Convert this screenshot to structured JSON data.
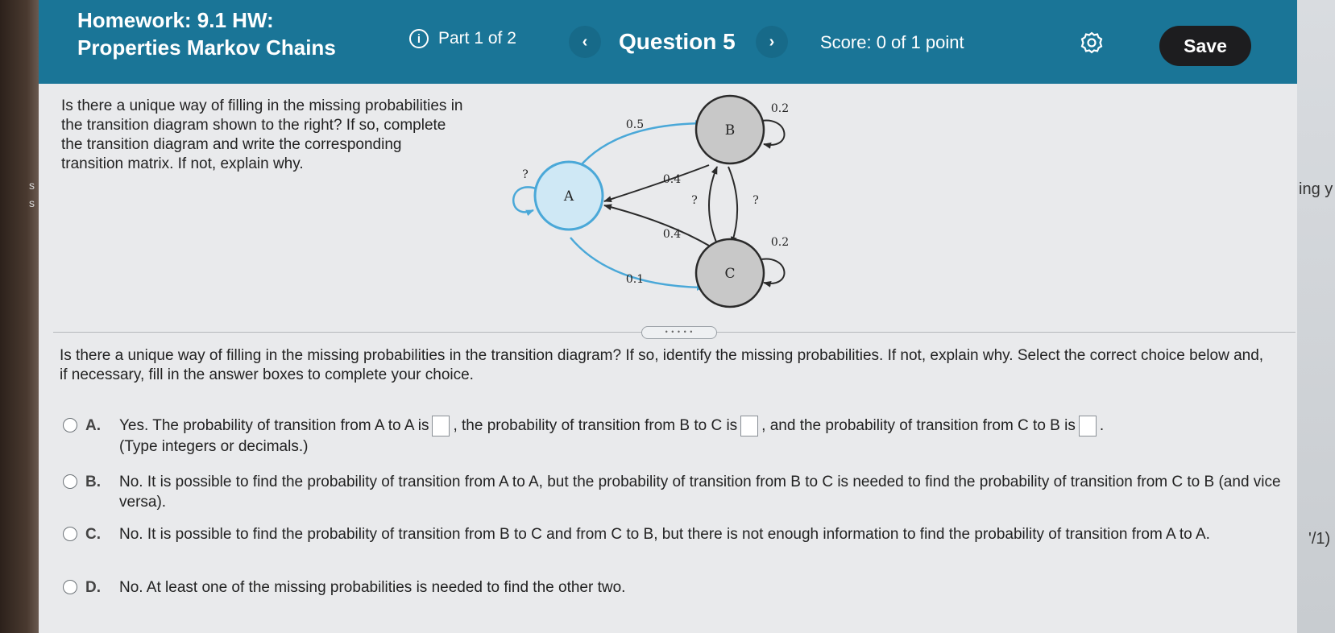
{
  "left_fragments": [
    "s",
    "s"
  ],
  "right_fragments": [
    "ing y",
    "'/1)"
  ],
  "header": {
    "title_line1": "Homework: 9.1 HW:",
    "title_line2": "Properties Markov Chains",
    "part": "Part 1 of 2",
    "question": "Question 5",
    "score": "Score: 0 of 1 point",
    "save_label": "Save"
  },
  "prompt": "Is there a unique way of filling in the missing probabilities in the transition diagram shown to the right? If so, complete the transition diagram and write the corresponding transition matrix. If not, explain why.",
  "diagram": {
    "nodes": {
      "a": "A",
      "b": "B",
      "c": "C"
    },
    "labels": {
      "a_to_b": "0.5",
      "b_to_a": "0.4",
      "c_to_a": "0.4",
      "a_to_c": "0.1",
      "a_loop": "?",
      "b_loop": "0.2",
      "c_loop": "0.2",
      "c_to_b": "?",
      "b_to_c": "?"
    },
    "colors": {
      "accent": "#4aa8d8",
      "node_gray": "#c8c8c8"
    }
  },
  "handle": "• • • • •",
  "instructions": "Is there a unique way of filling in the missing probabilities in the transition diagram? If so, identify the missing probabilities. If not, explain why. Select the correct choice below and, if necessary, fill in the answer boxes to complete your choice.",
  "choices": {
    "a": {
      "letter": "A.",
      "text1": "Yes. The probability of transition from A to A is",
      "text2": ", the probability of transition from B to C is",
      "text3": ", and the probability of transition from C to B is",
      "text4": ".",
      "note": "(Type integers or decimals.)"
    },
    "b": {
      "letter": "B.",
      "text": "No. It is possible to find the probability of transition from A to A, but the probability of transition from B to C is needed to find the probability of transition from C to B (and vice versa)."
    },
    "c": {
      "letter": "C.",
      "text": "No. It is possible to find the probability of transition from B to C and from C to B, but there is not enough information to find the probability of transition from A to A."
    },
    "d": {
      "letter": "D.",
      "text": "No. At least one of the missing probabilities is needed to find the other two."
    }
  }
}
